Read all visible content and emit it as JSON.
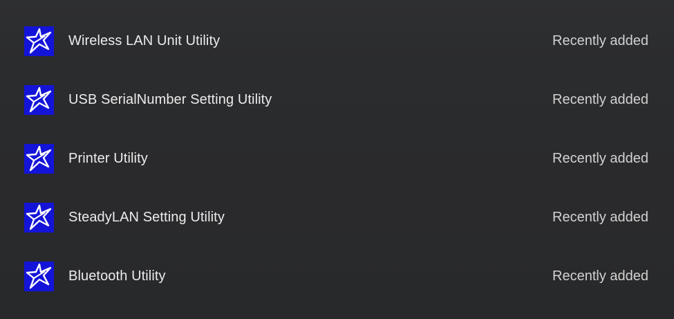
{
  "apps": [
    {
      "name": "Wireless LAN Unit Utility",
      "status": "Recently added",
      "icon": "star-logo-icon"
    },
    {
      "name": "USB SerialNumber Setting Utility",
      "status": "Recently added",
      "icon": "star-logo-icon"
    },
    {
      "name": "Printer Utility",
      "status": "Recently added",
      "icon": "star-logo-icon"
    },
    {
      "name": "SteadyLAN Setting Utility",
      "status": "Recently added",
      "icon": "star-logo-icon"
    },
    {
      "name": "Bluetooth Utility",
      "status": "Recently added",
      "icon": "star-logo-icon"
    }
  ],
  "colors": {
    "icon_background": "#1414d8",
    "icon_foreground": "#ffffff",
    "panel_background": "#2a2b2e",
    "text_primary": "#ececec",
    "text_secondary": "#d2d2d2"
  }
}
